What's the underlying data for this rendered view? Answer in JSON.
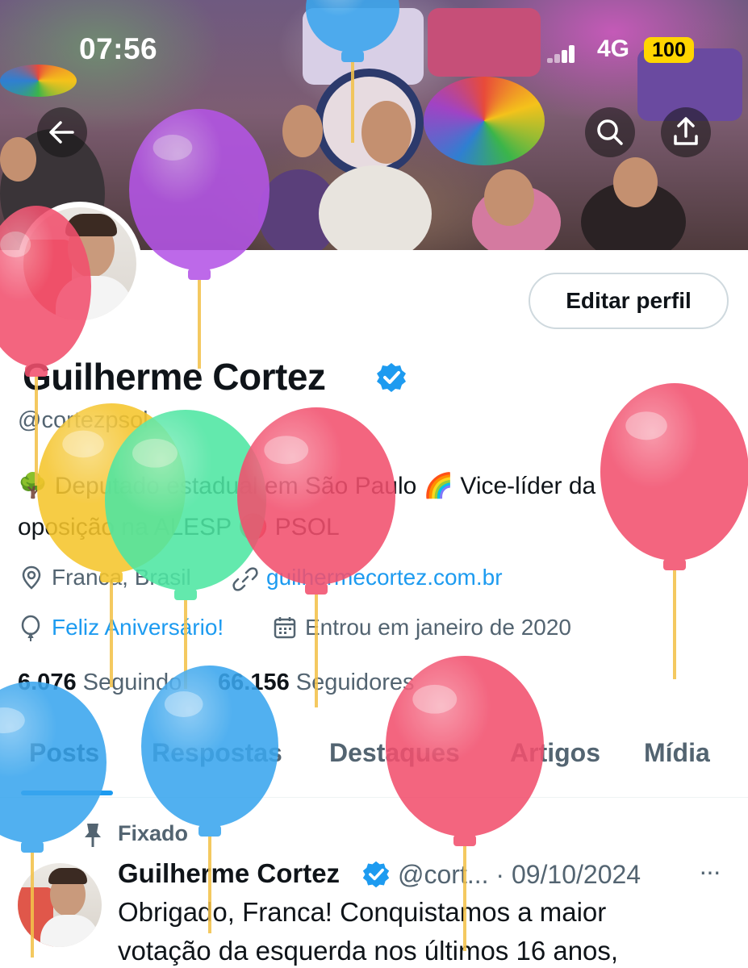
{
  "status_bar": {
    "time": "07:56",
    "network": "4G",
    "battery": "100"
  },
  "header": {
    "back_icon": "arrow-left-icon",
    "search_icon": "search-icon",
    "share_icon": "share-icon"
  },
  "profile": {
    "edit_button": "Editar perfil",
    "name": "Guilherme Cortez",
    "verified_icon": "verified-badge-icon",
    "handle": "@cortezpsol",
    "bio_line1": "🌳 Deputado estadual em São Paulo 🌈 Vice-líder da",
    "bio_line2": "oposição na ALESP 🔴 PSOL",
    "location": "Franca, Brasil",
    "website": "guilhermecortez.com.br",
    "birthday": "Feliz Aniversário!",
    "joined": "Entrou em janeiro de 2020",
    "following_count": "6.076",
    "following_label": "Seguindo",
    "followers_count": "66.156",
    "followers_label": "Seguidores"
  },
  "tabs": [
    "Posts",
    "Respostas",
    "Destaques",
    "Artigos",
    "Mídia"
  ],
  "pinned_post": {
    "pinned_label": "Fixado",
    "author_name": "Guilherme Cortez",
    "author_handle": "@cort...",
    "date": "· 09/10/2024",
    "more": "···",
    "text_line1": "Obrigado, Franca! Conquistamos a maior",
    "text_line2": "votação da esquerda nos últimos 16 anos,"
  },
  "colors": {
    "accent": "#1d9bf0",
    "secondary_text": "#536471",
    "balloon_purple": "#b455e6",
    "balloon_red": "#f2506e",
    "balloon_yellow": "#f5c52c",
    "balloon_green": "#4ee6a2",
    "balloon_blue": "#3aa6ee"
  }
}
